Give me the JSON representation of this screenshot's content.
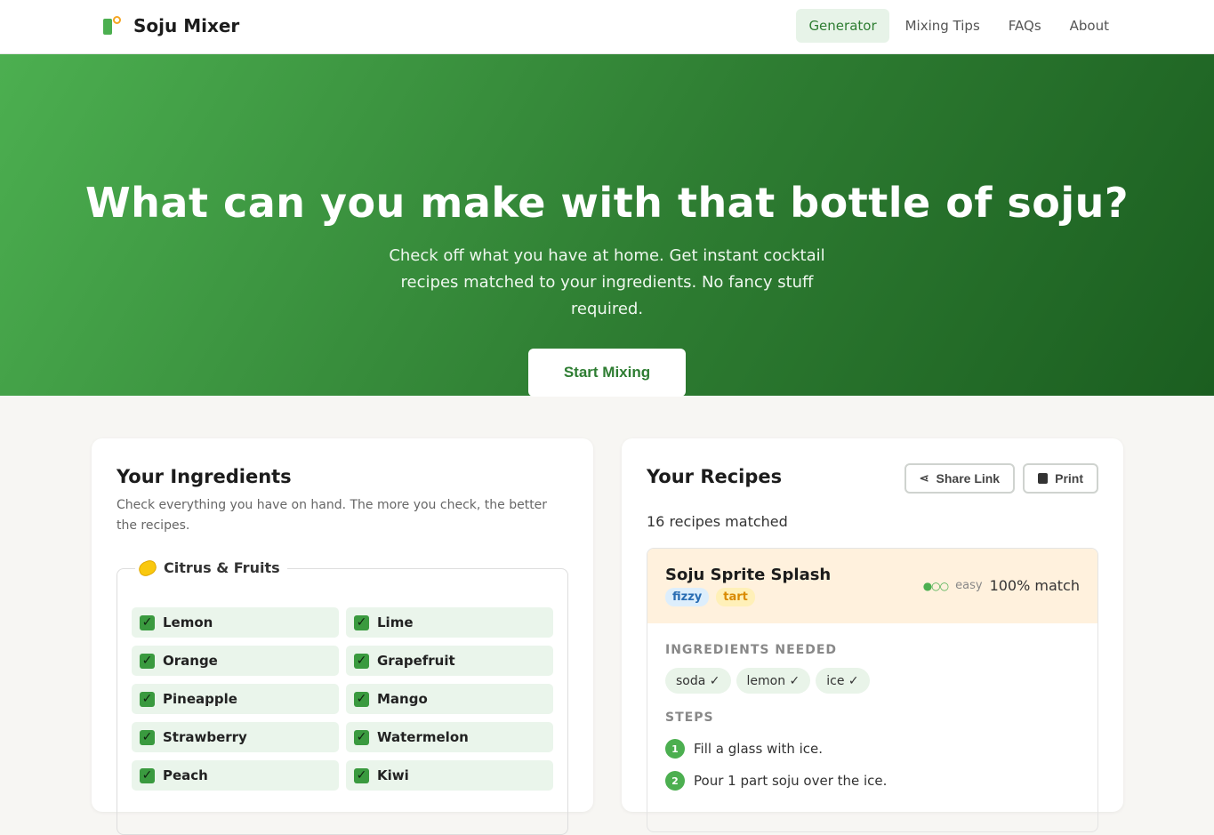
{
  "header": {
    "brand": "Soju Mixer",
    "nav": [
      {
        "label": "Generator",
        "active": true
      },
      {
        "label": "Mixing Tips",
        "active": false
      },
      {
        "label": "FAQs",
        "active": false
      },
      {
        "label": "About",
        "active": false
      }
    ]
  },
  "hero": {
    "title": "What can you make with that bottle of soju?",
    "subtitle": "Check off what you have at home. Get instant cocktail recipes matched to your ingredients. No fancy stuff required.",
    "cta": "Start Mixing"
  },
  "ingredients": {
    "title": "Your Ingredients",
    "description": "Check everything you have on hand. The more you check, the better the recipes.",
    "group": {
      "icon": "lemon-icon",
      "label": "Citrus & Fruits",
      "items": [
        {
          "label": "Lemon",
          "checked": true
        },
        {
          "label": "Lime",
          "checked": true
        },
        {
          "label": "Orange",
          "checked": true
        },
        {
          "label": "Grapefruit",
          "checked": true
        },
        {
          "label": "Pineapple",
          "checked": true
        },
        {
          "label": "Mango",
          "checked": true
        },
        {
          "label": "Strawberry",
          "checked": true
        },
        {
          "label": "Watermelon",
          "checked": true
        },
        {
          "label": "Peach",
          "checked": true
        },
        {
          "label": "Kiwi",
          "checked": true
        }
      ]
    }
  },
  "recipes": {
    "title": "Your Recipes",
    "share_label": "Share Link",
    "print_label": "Print",
    "matched_text": "16 recipes matched",
    "first": {
      "name": "Soju Sprite Splash",
      "tags": [
        "fizzy",
        "tart"
      ],
      "difficulty_dots": "●○○",
      "difficulty": "easy",
      "match": "100% match",
      "ingredients_label": "INGREDIENTS NEEDED",
      "ingredients": [
        "soda ✓",
        "lemon ✓",
        "ice ✓"
      ],
      "steps_label": "STEPS",
      "steps": [
        {
          "num": "1",
          "text": "Fill a glass with ice."
        },
        {
          "num": "2",
          "text": "Pour 1 part soju over the ice."
        }
      ]
    }
  },
  "colors": {
    "accent": "#4caf50",
    "accent_dark": "#2e7d32",
    "recipe_head_bg": "#fff1dd"
  }
}
